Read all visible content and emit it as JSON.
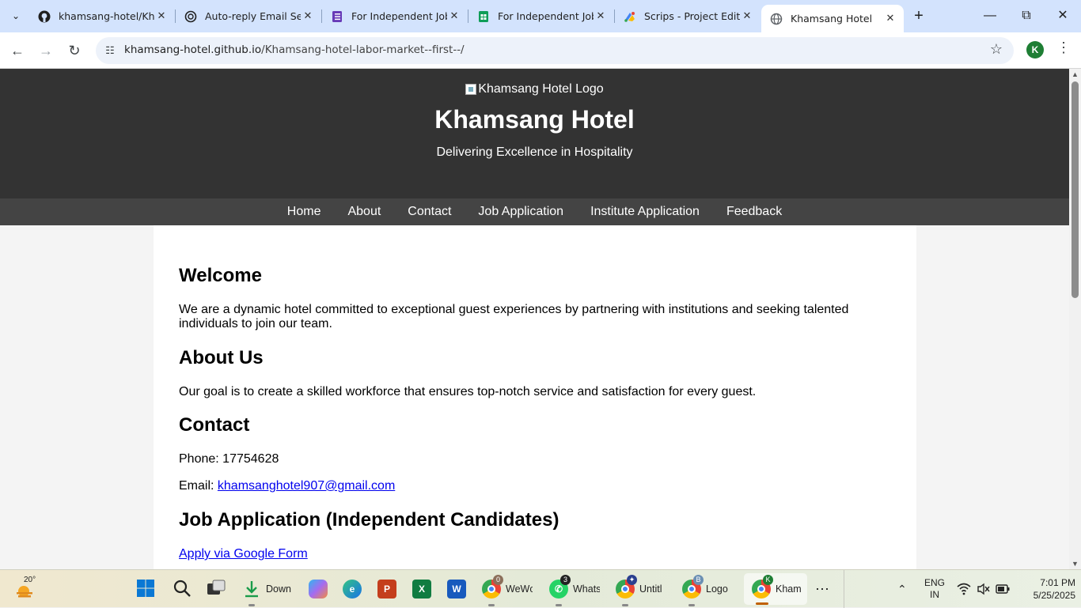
{
  "browser": {
    "tabs": [
      {
        "title": "khamsang-hotel/Khamsang-hotel-labor-market--first--",
        "favicon": "github-icon",
        "active": false
      },
      {
        "title": "Auto-reply Email Setup",
        "favicon": "chatgpt-icon",
        "active": false
      },
      {
        "title": "For Independent Job",
        "favicon": "forms-icon",
        "active": false
      },
      {
        "title": "For Independent Job",
        "favicon": "sheets-icon",
        "active": false
      },
      {
        "title": "Scrips - Project Editor",
        "favicon": "apps-script-icon",
        "active": false
      },
      {
        "title": "Khamsang Hotel",
        "favicon": "globe-icon",
        "active": true
      }
    ],
    "url_host": "khamsang-hotel.github.io",
    "url_path": "/Khamsang-hotel-labor-market--first--/",
    "profile_initial": "K"
  },
  "page": {
    "logo_alt": "Khamsang Hotel Logo",
    "title": "Khamsang Hotel",
    "tagline": "Delivering Excellence in Hospitality",
    "nav": [
      "Home",
      "About",
      "Contact",
      "Job Application",
      "Institute Application",
      "Feedback"
    ],
    "welcome": {
      "heading": "Welcome",
      "text": "We are a dynamic hotel committed to exceptional guest experiences by partnering with institutions and seeking talented individuals to join our team."
    },
    "about": {
      "heading": "About Us",
      "text": "Our goal is to create a skilled workforce that ensures top-notch service and satisfaction for every guest."
    },
    "contact": {
      "heading": "Contact",
      "phone_label": "Phone:",
      "phone": "17754628",
      "email_label": "Email:",
      "email": "khamsanghotel907@gmail.com"
    },
    "job": {
      "heading": "Job Application (Independent Candidates)",
      "link": "Apply via Google Form"
    }
  },
  "taskbar": {
    "weather_temp": "20°",
    "apps": [
      {
        "name": "Downloads",
        "label": "Down",
        "icon": "download-icon"
      },
      {
        "name": "Copilot",
        "label": "",
        "icon": "copilot-icon"
      },
      {
        "name": "Edge",
        "label": "",
        "icon": "edge-icon"
      },
      {
        "name": "PowerPoint",
        "label": "",
        "icon": "powerpoint-icon"
      },
      {
        "name": "Excel",
        "label": "",
        "icon": "excel-icon"
      },
      {
        "name": "Word",
        "label": "",
        "icon": "word-icon"
      },
      {
        "name": "Chrome WeWork",
        "label": "WeWc",
        "icon": "chrome-icon",
        "badge": "0"
      },
      {
        "name": "WhatsApp",
        "label": "Whats",
        "icon": "whatsapp-icon",
        "badge": "3"
      },
      {
        "name": "Chrome Untitled",
        "label": "Untitl",
        "icon": "chrome-icon"
      },
      {
        "name": "Chrome Logo",
        "label": "Logo",
        "icon": "chrome-icon",
        "badge": "B"
      },
      {
        "name": "Chrome Khamsang",
        "label": "Kham",
        "icon": "chrome-icon",
        "badge": "K"
      }
    ],
    "lang_top": "ENG",
    "lang_bottom": "IN",
    "time": "7:01 PM",
    "date": "5/25/2025"
  },
  "colors": {
    "header_bg": "#333333",
    "nav_bg": "#444444",
    "link": "#0000ee",
    "tabstrip": "#d3e3fd"
  }
}
